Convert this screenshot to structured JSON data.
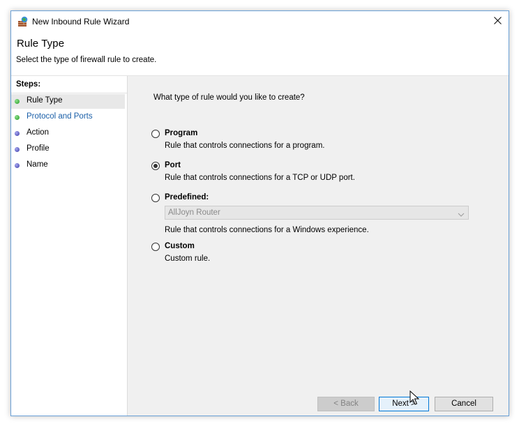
{
  "window": {
    "title": "New Inbound Rule Wizard"
  },
  "header": {
    "title": "Rule Type",
    "subtitle": "Select the type of firewall rule to create."
  },
  "steps": {
    "heading": "Steps:",
    "items": [
      {
        "label": "Rule Type",
        "status": "complete",
        "active": true
      },
      {
        "label": "Protocol and Ports",
        "status": "complete",
        "active": false
      },
      {
        "label": "Action",
        "status": "pending",
        "active": false
      },
      {
        "label": "Profile",
        "status": "pending",
        "active": false
      },
      {
        "label": "Name",
        "status": "pending",
        "active": false
      }
    ]
  },
  "main": {
    "question": "What type of rule would you like to create?",
    "options": [
      {
        "label": "Program",
        "description": "Rule that controls connections for a program.",
        "selected": false
      },
      {
        "label": "Port",
        "description": "Rule that controls connections for a TCP or UDP port.",
        "selected": true
      },
      {
        "label": "Predefined:",
        "description": "Rule that controls connections for a Windows experience.",
        "selected": false
      },
      {
        "label": "Custom",
        "description": "Custom rule.",
        "selected": false
      }
    ],
    "predefined_select": {
      "value": "AllJoyn Router",
      "disabled": true
    }
  },
  "buttons": {
    "back": "< Back",
    "next": "Next >",
    "cancel": "Cancel"
  },
  "icons": {
    "app": "firewall-wizard-icon",
    "close": "close-icon",
    "step_complete": "green-bullet-icon",
    "step_pending": "blue-bullet-icon",
    "dropdown": "chevron-down-icon",
    "cursor": "mouse-pointer-icon"
  },
  "colors": {
    "link": "#1a5fa8",
    "next_button_border": "#0078d7",
    "content_bg": "#f0f0f0"
  }
}
